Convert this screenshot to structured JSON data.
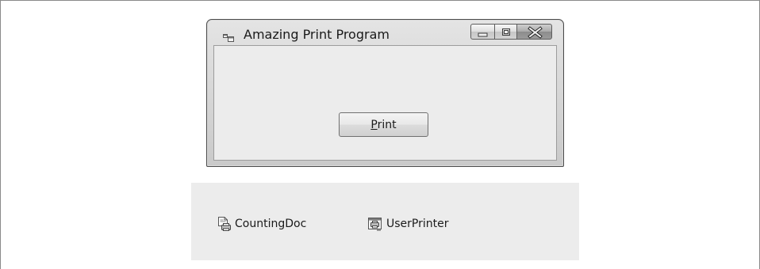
{
  "window": {
    "title": "Amazing Print Program",
    "caption_buttons": [
      "minimize",
      "maximize",
      "close"
    ],
    "print_button": {
      "label_access_key": "P",
      "label_rest": "rint"
    }
  },
  "component_tray": {
    "items": [
      {
        "label": "CountingDoc",
        "icon": "print-document-icon"
      },
      {
        "label": "UserPrinter",
        "icon": "printer-dialog-icon"
      }
    ]
  }
}
